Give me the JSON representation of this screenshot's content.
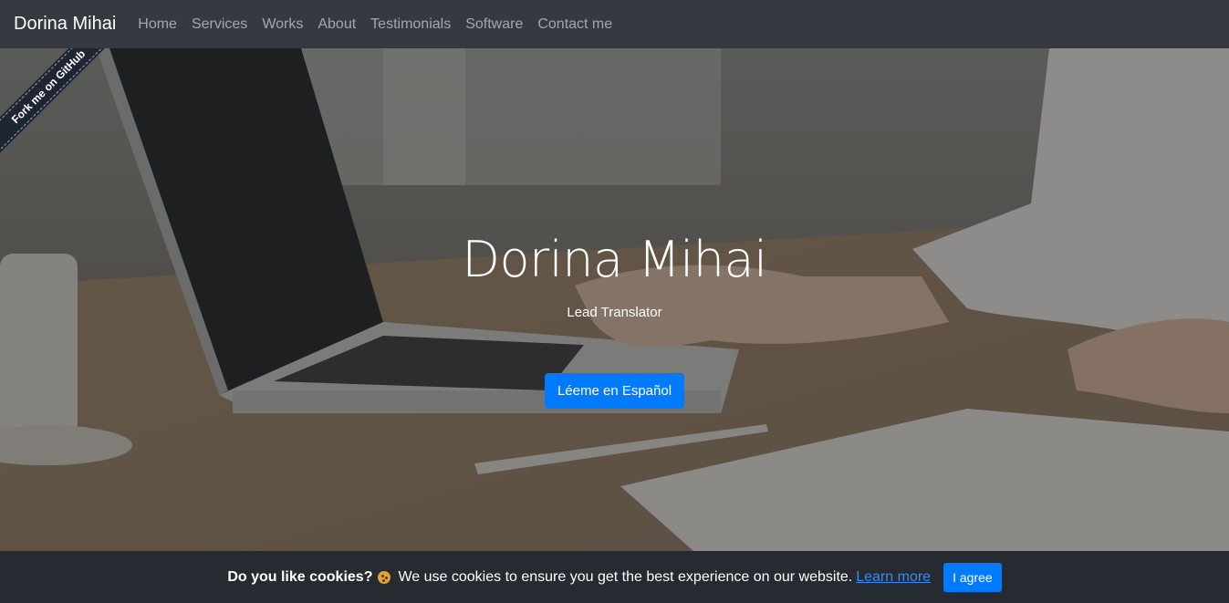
{
  "navbar": {
    "brand": "Dorina Mihai",
    "items": [
      "Home",
      "Services",
      "Works",
      "About",
      "Testimonials",
      "Software",
      "Contact me"
    ]
  },
  "ribbon": {
    "label": "Fork me on GitHub"
  },
  "hero": {
    "title": "Dorina Mihai",
    "subtitle": "Lead Translator",
    "button_label": "Léeme en Español"
  },
  "cookie_bar": {
    "question": "Do you like cookies?",
    "icon": "cookie-icon",
    "message": "We use cookies to ensure you get the best experience on our website.",
    "link_label": "Learn more",
    "button_label": "I agree"
  },
  "colors": {
    "navbar_bg": "#343a40",
    "primary": "#007bff",
    "cookie_bg": "#262a31"
  }
}
